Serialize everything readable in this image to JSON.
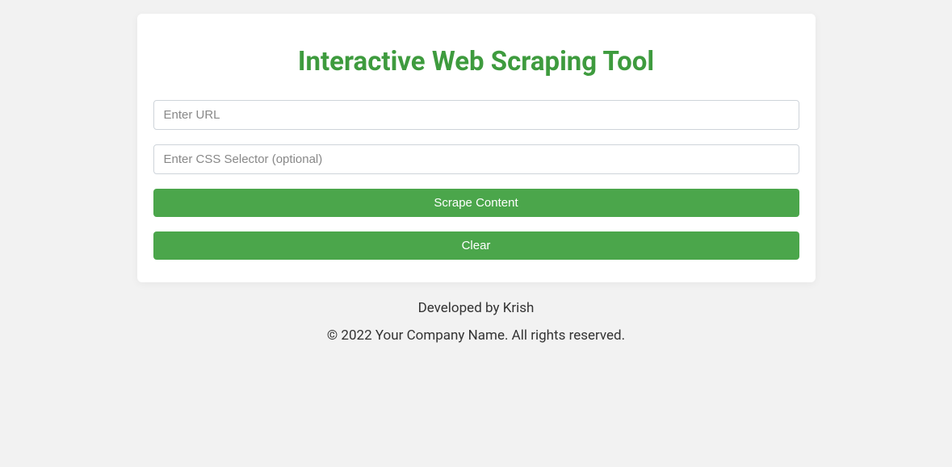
{
  "header": {
    "title": "Interactive Web Scraping Tool"
  },
  "form": {
    "url_input": {
      "placeholder": "Enter URL",
      "value": ""
    },
    "selector_input": {
      "placeholder": "Enter CSS Selector (optional)",
      "value": ""
    },
    "scrape_button_label": "Scrape Content",
    "clear_button_label": "Clear"
  },
  "footer": {
    "developer": "Developed by Krish",
    "copyright": "© 2022 Your Company Name. All rights reserved."
  }
}
